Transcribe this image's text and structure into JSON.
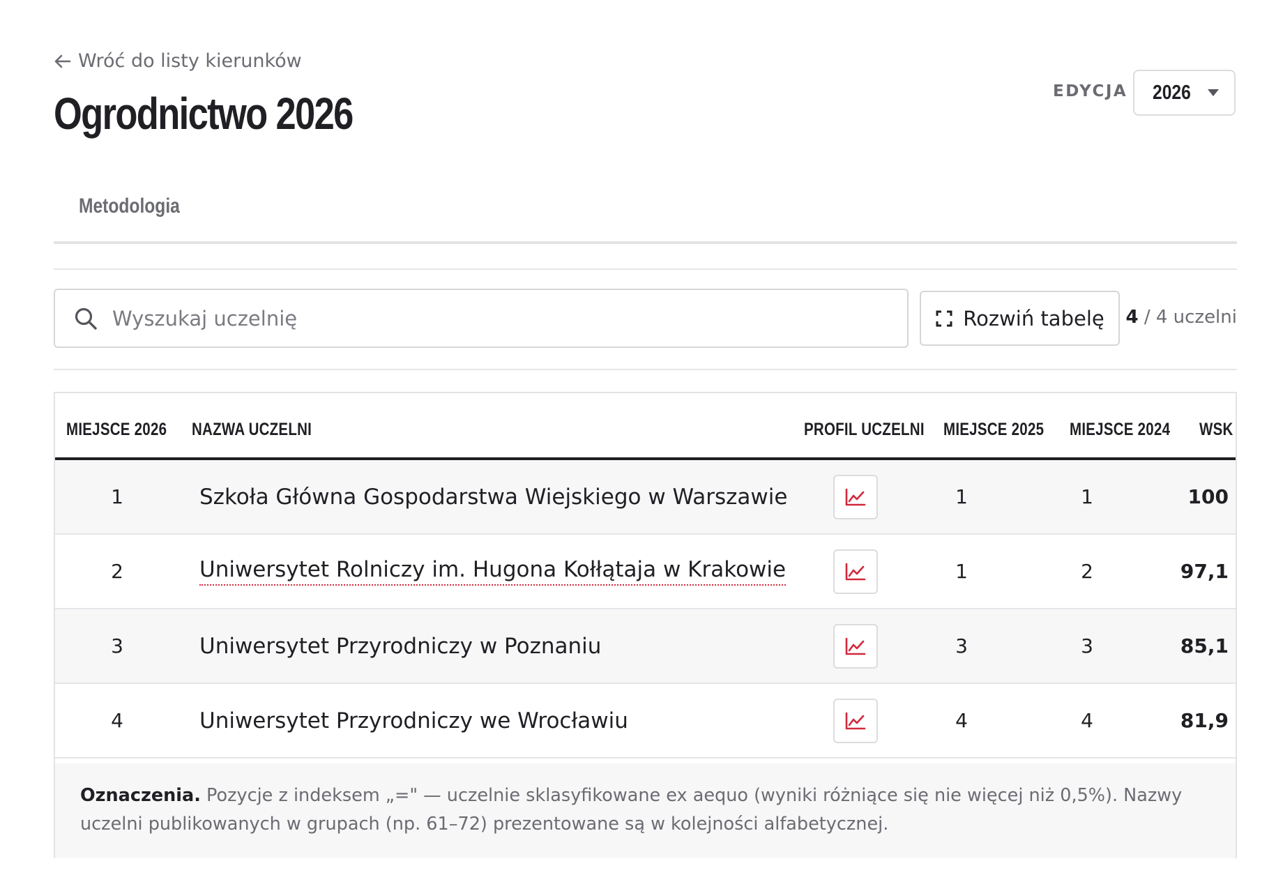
{
  "back_link": {
    "label": "Wróć do listy kierunków"
  },
  "page_title": "Ogrodnictwo 2026",
  "edition": {
    "label": "EDYCJA",
    "selected": "2026"
  },
  "tabs": [
    {
      "label": "Metodologia"
    }
  ],
  "search": {
    "placeholder": "Wyszukaj uczelnię",
    "value": ""
  },
  "expand_button": {
    "label": "Rozwiń tabelę"
  },
  "count": {
    "shown": "4",
    "total_text": "/ 4 uczelni"
  },
  "table": {
    "headers": {
      "rank": "MIEJSCE 2026",
      "name": "NAZWA UCZELNI",
      "profile": "PROFIL UCZELNI",
      "rank_2025": "MIEJSCE 2025",
      "rank_2024": "MIEJSCE 2024",
      "wsk": "WSK"
    },
    "rows": [
      {
        "rank": "1",
        "name": "Szkoła Główna Gospodarstwa Wiejskiego w Warszawie",
        "rank_2025": "1",
        "rank_2024": "1",
        "wsk": "100",
        "linked": false
      },
      {
        "rank": "2",
        "name": "Uniwersytet Rolniczy im. Hugona Kołłątaja w Krakowie",
        "rank_2025": "1",
        "rank_2024": "2",
        "wsk": "97,1",
        "linked": true
      },
      {
        "rank": "3",
        "name": "Uniwersytet Przyrodniczy w Poznaniu",
        "rank_2025": "3",
        "rank_2024": "3",
        "wsk": "85,1",
        "linked": false
      },
      {
        "rank": "4",
        "name": "Uniwersytet Przyrodniczy we Wrocławiu",
        "rank_2025": "4",
        "rank_2024": "4",
        "wsk": "81,9",
        "linked": false
      }
    ]
  },
  "legend": {
    "title": "Oznaczenia.",
    "text": "Pozycje z indeksem „=\" — uczelnie sklasyfikowane ex aequo (wyniki różniące się nie więcej niż 0,5%). Nazwy uczelni publikowanych w grupach (np. 61–72) prezentowane są w kolejności alfabetycznej."
  },
  "colors": {
    "accent": "#d2283b",
    "text": "#1f1f24",
    "muted": "#6b6b72",
    "row_shade": "#f7f7f8"
  },
  "icons": {
    "back": "arrow-left-icon",
    "search": "search-icon",
    "expand": "expand-icon",
    "profile": "line-chart-icon",
    "select": "caret-down-icon"
  }
}
